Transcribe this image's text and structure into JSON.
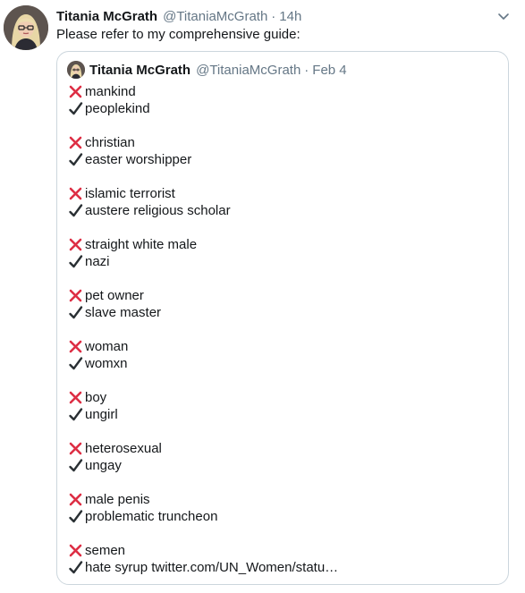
{
  "tweet": {
    "author_name": "Titania McGrath",
    "author_handle": "@TitaniaMcGrath",
    "separator": "·",
    "time": "14h",
    "text": "Please refer to my comprehensive guide:"
  },
  "quote": {
    "author_name": "Titania McGrath",
    "author_handle": "@TitaniaMcGrath",
    "separator": "·",
    "date": "Feb 4",
    "pairs": [
      {
        "wrong": "mankind",
        "right": "peoplekind"
      },
      {
        "wrong": "christian",
        "right": "easter worshipper"
      },
      {
        "wrong": "islamic terrorist",
        "right": "austere religious scholar"
      },
      {
        "wrong": "straight white male",
        "right": "nazi"
      },
      {
        "wrong": "pet owner",
        "right": "slave master"
      },
      {
        "wrong": "woman",
        "right": "womxn"
      },
      {
        "wrong": "boy",
        "right": "ungirl"
      },
      {
        "wrong": "heterosexual",
        "right": "ungay"
      },
      {
        "wrong": "male penis",
        "right": "problematic truncheon"
      },
      {
        "wrong": "semen",
        "right": "hate syrup",
        "link": "twitter.com/UN_Women/statu…"
      }
    ]
  },
  "icons": {
    "wrong": "cross-mark-icon",
    "right": "check-mark-icon",
    "menu": "chevron-down-icon"
  },
  "colors": {
    "cross": "#dd2e44",
    "check": "#292f33",
    "muted": "#657786",
    "border": "#ccd6dd"
  }
}
